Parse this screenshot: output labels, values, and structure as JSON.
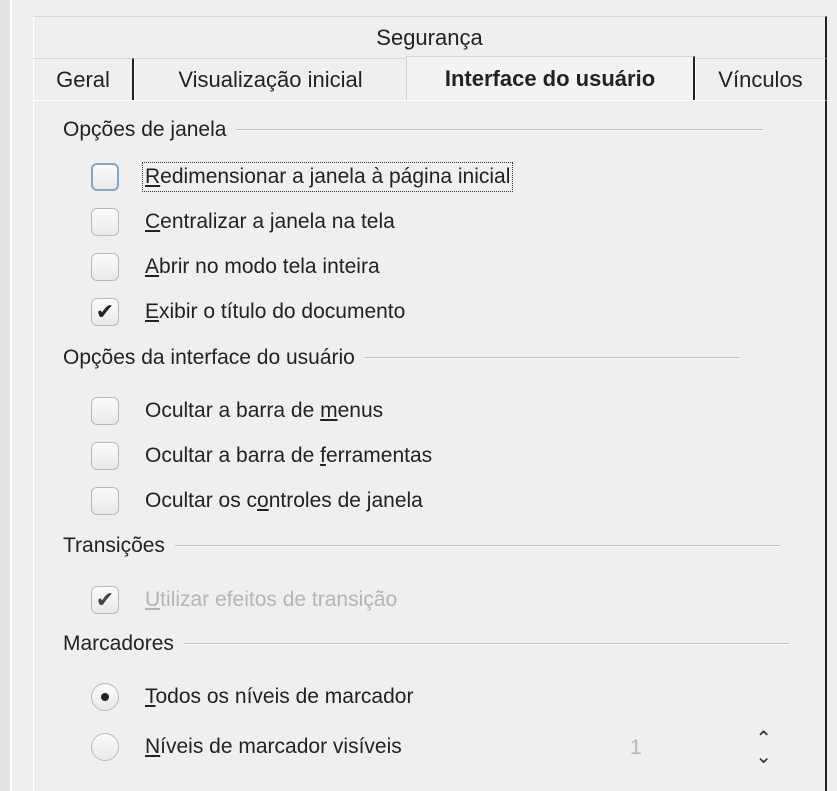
{
  "tabs_row1": {
    "security": "Segurança"
  },
  "tabs_row2": {
    "general": "Geral",
    "initial_view": "Visualização inicial",
    "user_interface": "Interface do usuário",
    "links": "Vínculos"
  },
  "window_options": {
    "header": "Opções de janela",
    "resize_pre": "",
    "resize_u": "R",
    "resize_post": "edimensionar a janela à página inicial",
    "resize_checked": false,
    "center_u": "C",
    "center_post": "entralizar a janela na tela",
    "center_checked": false,
    "fullscreen_u": "A",
    "fullscreen_post": "brir no modo tela inteira",
    "fullscreen_checked": false,
    "title_u": "E",
    "title_post": "xibir o título do documento",
    "title_checked": true
  },
  "ui_options": {
    "header": "Opções da interface do usuário",
    "hide_menubar_pre": "Ocultar a barra de ",
    "hide_menubar_u": "m",
    "hide_menubar_post": "enus",
    "hide_toolbar_pre": "Ocultar a barra de ",
    "hide_toolbar_u": "f",
    "hide_toolbar_post": "erramentas",
    "hide_controls_pre": "Ocultar os c",
    "hide_controls_u": "o",
    "hide_controls_post": "ntroles de janela"
  },
  "transitions": {
    "header": "Transições",
    "use_effects_u": "U",
    "use_effects_post": "tilizar efeitos de transição",
    "use_effects_checked": true
  },
  "bookmarks": {
    "header": "Marcadores",
    "all_levels_u": "T",
    "all_levels_post": "odos os níveis de marcador",
    "all_levels_selected": true,
    "visible_levels_u": "N",
    "visible_levels_post": "íveis de marcador visíveis",
    "visible_levels_value": "1"
  },
  "icons": {
    "check": "check-icon",
    "spin_up": "chevron-up-icon",
    "spin_down": "chevron-down-icon"
  }
}
